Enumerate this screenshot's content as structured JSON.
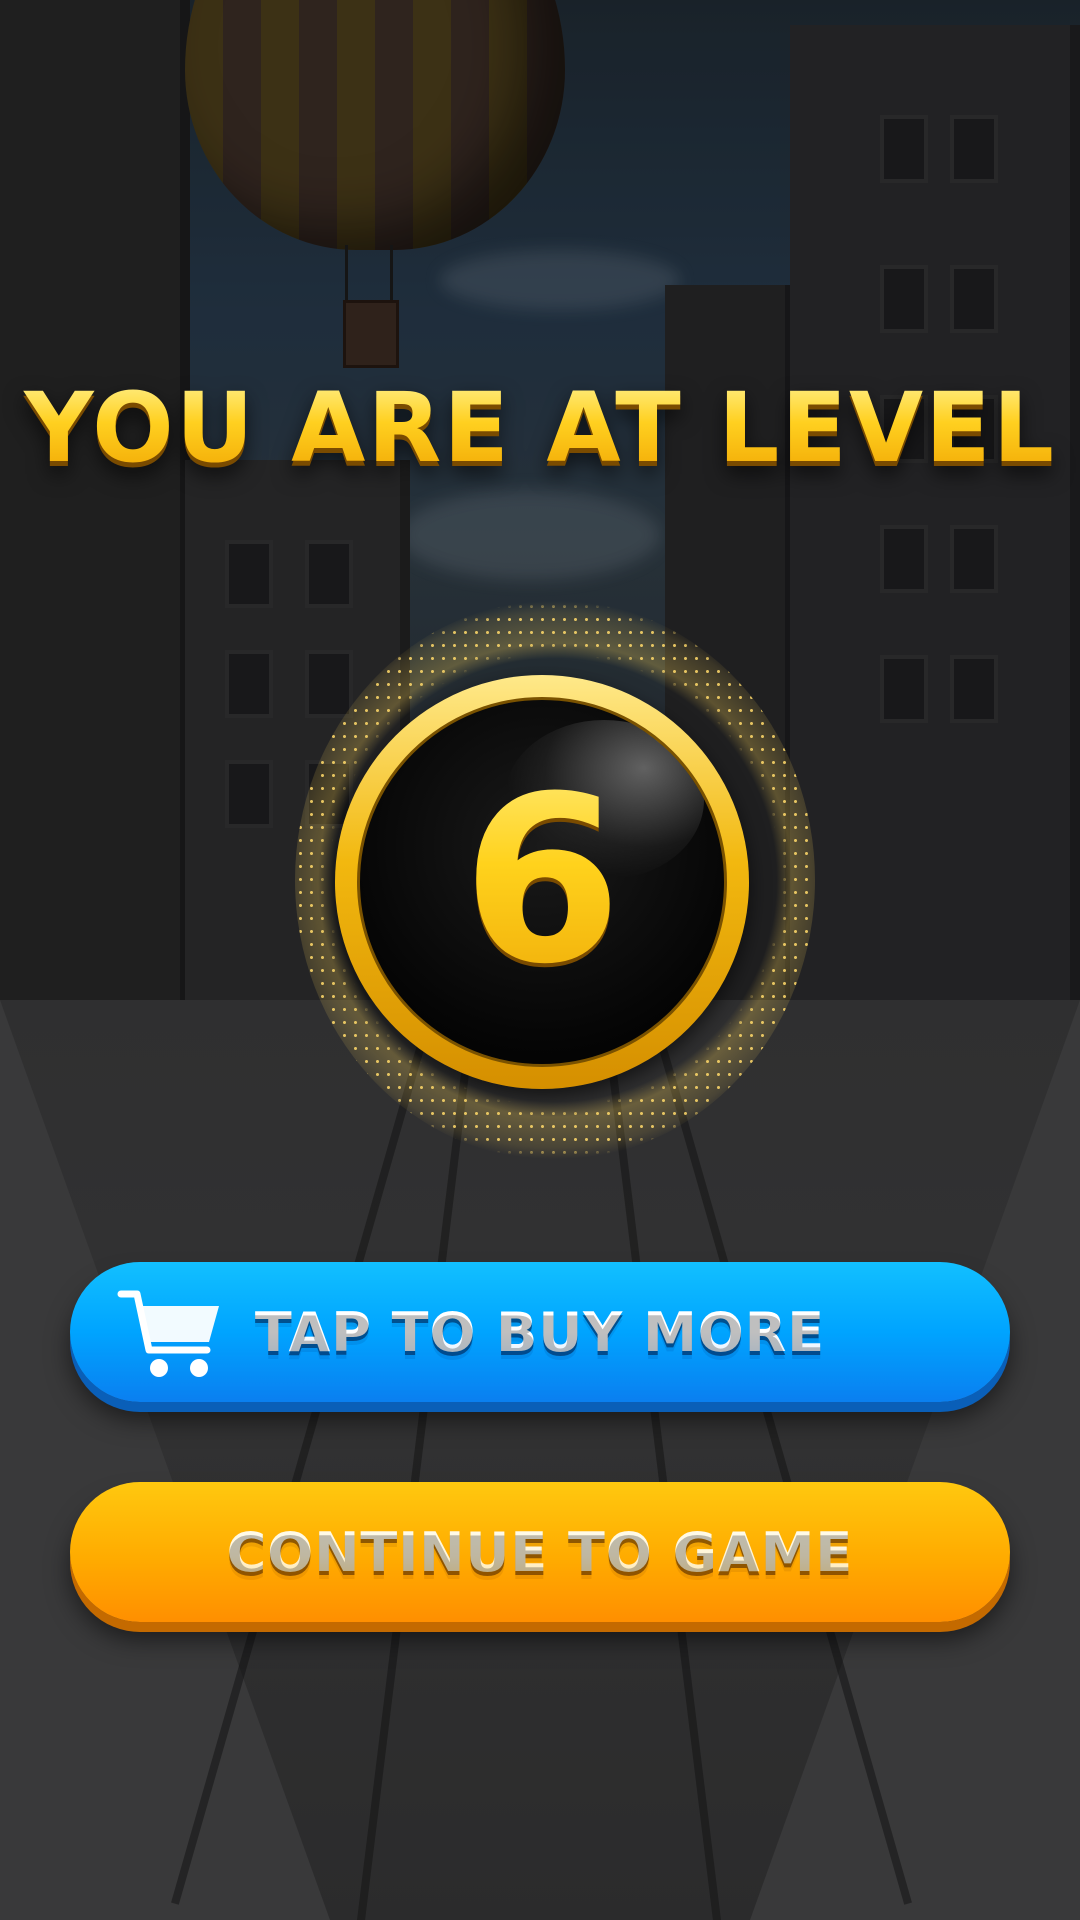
{
  "level_screen": {
    "title": "YOU ARE AT LEVEL",
    "level": "6"
  },
  "buttons": {
    "buy_label": "TAP TO BUY MORE",
    "continue_label": "CONTINUE TO GAME"
  },
  "icons": {
    "cart": "shopping-cart-icon"
  },
  "colors": {
    "title_gold": "#ffd020",
    "buy_button": "#00a4ff",
    "continue_button": "#ffab00",
    "badge_ring": "#f2b80f"
  }
}
